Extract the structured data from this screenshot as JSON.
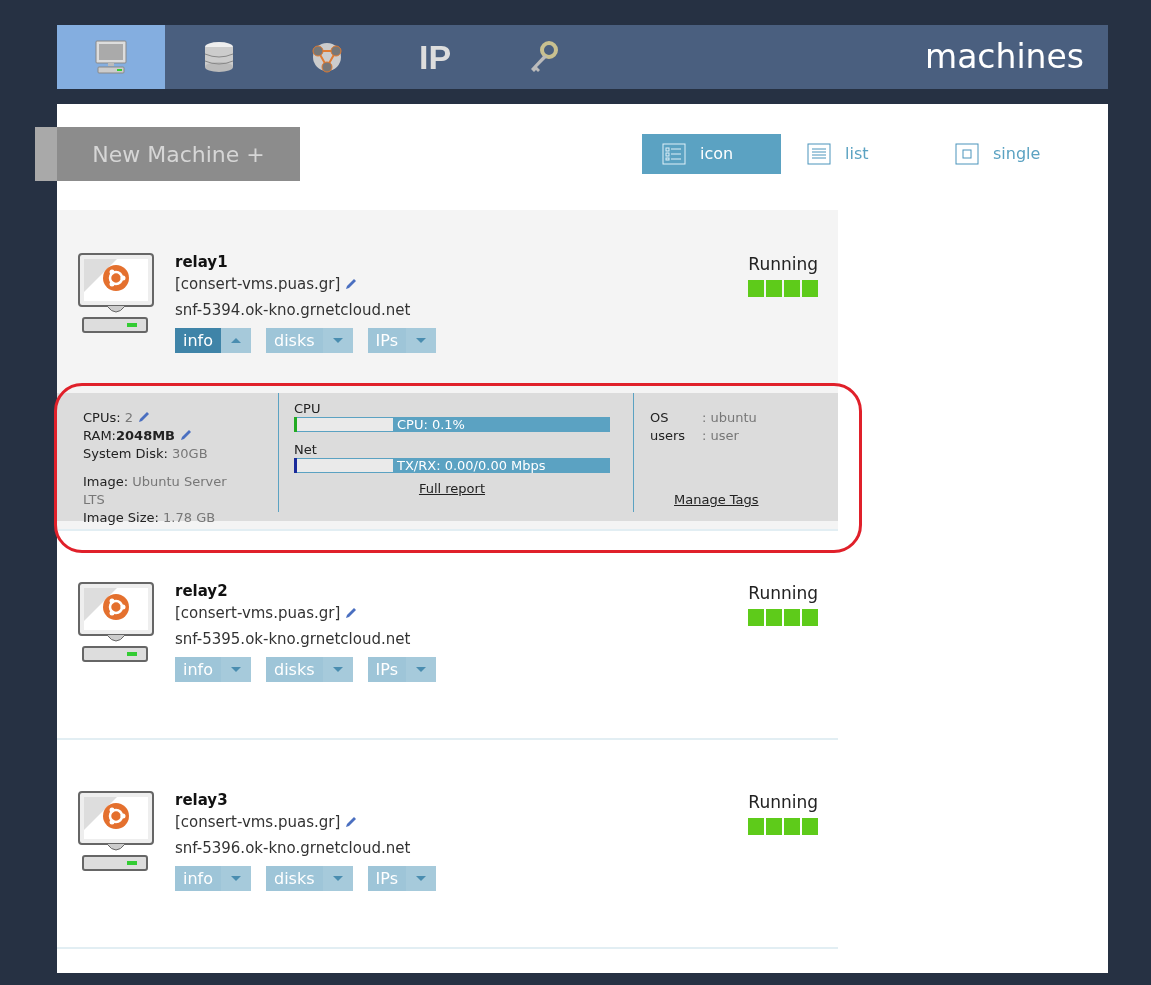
{
  "nav_tabs": [
    {
      "kind": "monitor",
      "selected": true
    },
    {
      "kind": "database",
      "selected": false
    },
    {
      "kind": "network",
      "selected": false
    },
    {
      "kind": "text",
      "label": "IP",
      "selected": false
    },
    {
      "kind": "key",
      "selected": false
    }
  ],
  "page_title": "machines",
  "new_machine_button": "New Machine +",
  "view_modes": [
    {
      "kind": "icon",
      "label": "icon",
      "selected": true
    },
    {
      "kind": "list",
      "label": "list",
      "selected": false
    },
    {
      "kind": "single",
      "label": "single",
      "selected": false
    }
  ],
  "machines": [
    {
      "name": "relay1",
      "project": "[consert-vms.puas.gr]",
      "hostname": "snf-5394.ok-kno.grnetcloud.net",
      "status": "Running",
      "buttons": [
        {
          "label": "info",
          "expanded": true
        },
        {
          "label": "disks",
          "expanded": false
        },
        {
          "label": "IPs",
          "expanded": false
        }
      ],
      "details": {
        "highlighted": true,
        "specs": [
          {
            "label": "CPUs:",
            "value": "2",
            "editable": true,
            "bold": false
          },
          {
            "label": "RAM:",
            "value": "2048MB",
            "editable": true,
            "bold": true
          },
          {
            "label": "System Disk:",
            "value": "30GB",
            "editable": false,
            "bold": false
          },
          {
            "label": "Image:",
            "value": "Ubuntu Server LTS",
            "editable": false,
            "bold": false
          },
          {
            "label": "Image Size:",
            "value": "1.78 GB",
            "editable": false,
            "bold": false
          }
        ],
        "meters": [
          {
            "title": "CPU",
            "reading": "CPU: 0.1%",
            "level": 0.01,
            "color": "#22aa22"
          },
          {
            "title": "Net",
            "reading": "TX/RX: 0.00/0.00 Mbps",
            "level": 0.01,
            "color": "#1a2a9a"
          }
        ],
        "full_report_link": "Full report",
        "meta": [
          {
            "label": "OS",
            "value": ": ubuntu"
          },
          {
            "label": "users",
            "value": ": user"
          }
        ],
        "manage_tags_link": "Manage Tags"
      }
    },
    {
      "name": "relay2",
      "project": "[consert-vms.puas.gr]",
      "hostname": "snf-5395.ok-kno.grnetcloud.net",
      "status": "Running",
      "buttons": [
        {
          "label": "info",
          "expanded": false
        },
        {
          "label": "disks",
          "expanded": false
        },
        {
          "label": "IPs",
          "expanded": false
        }
      ]
    },
    {
      "name": "relay3",
      "project": "[consert-vms.puas.gr]",
      "hostname": "snf-5396.ok-kno.grnetcloud.net",
      "status": "Running",
      "buttons": [
        {
          "label": "info",
          "expanded": false
        },
        {
          "label": "disks",
          "expanded": false
        },
        {
          "label": "IPs",
          "expanded": false
        }
      ]
    }
  ]
}
